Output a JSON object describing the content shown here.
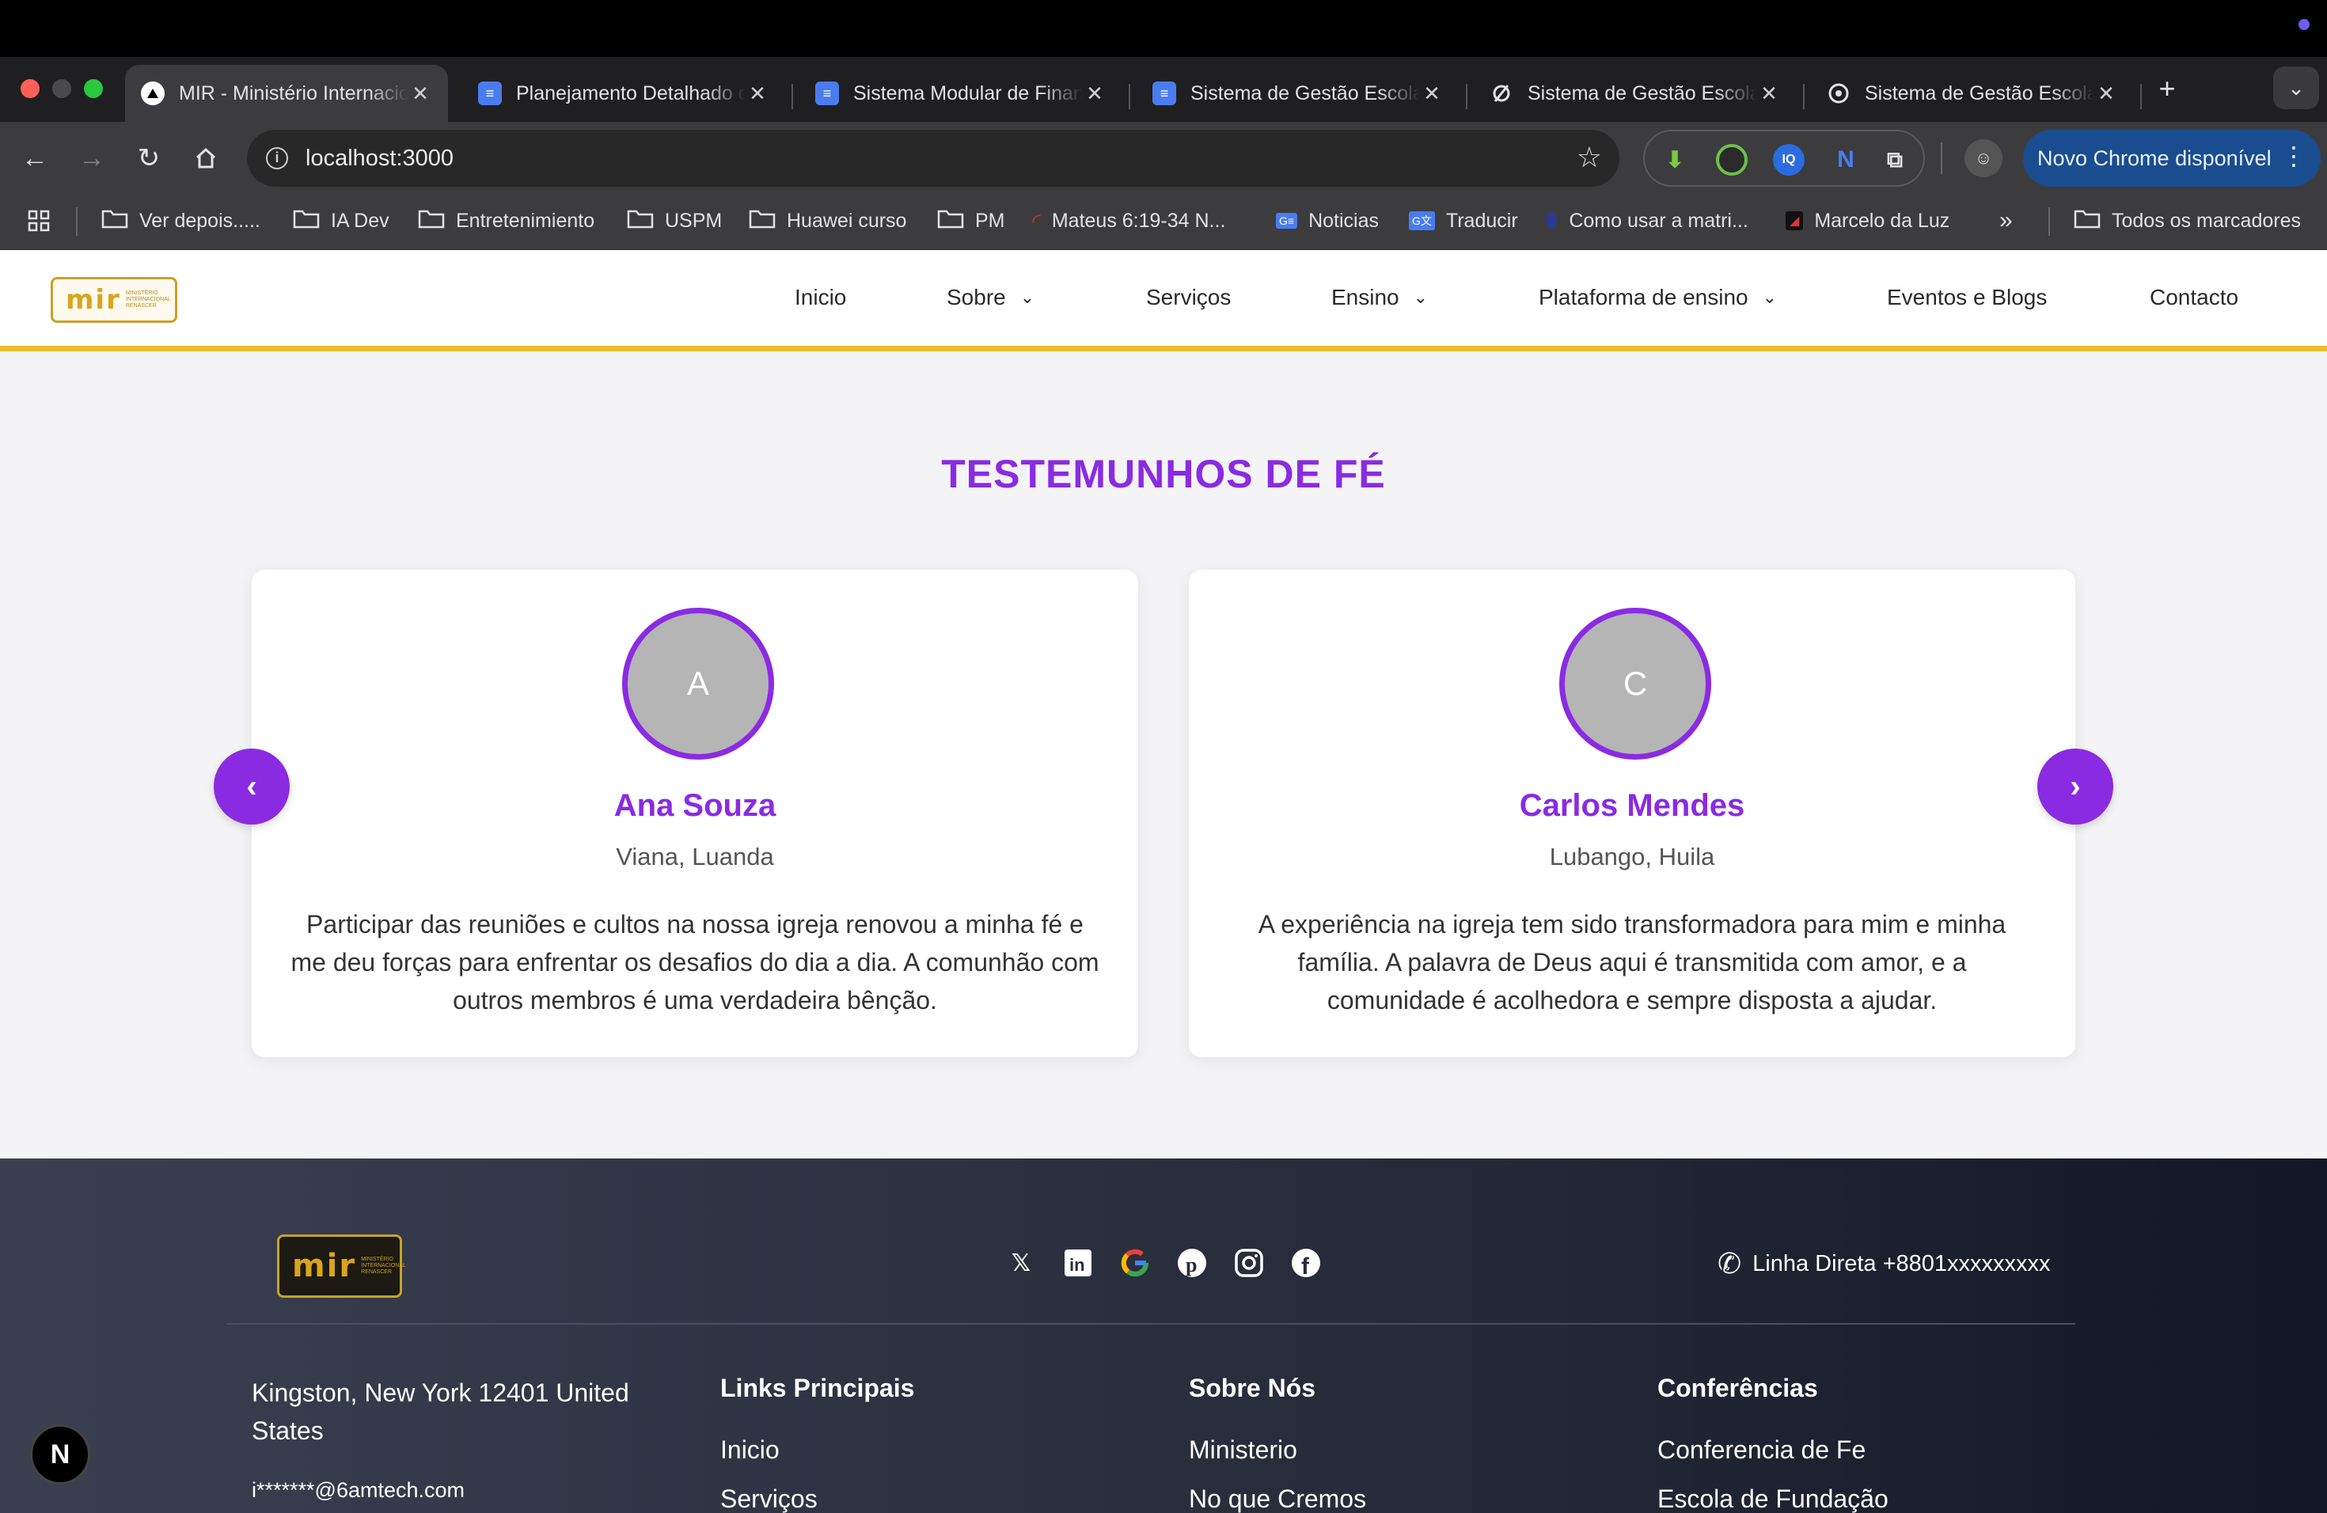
{
  "browser": {
    "tabs": [
      {
        "title": "MIR - Ministério Internacional",
        "favicon": "triangle-icon",
        "active": true
      },
      {
        "title": "Planejamento Detalhado do",
        "favicon": "docs-icon",
        "active": false
      },
      {
        "title": "Sistema Modular de Finanças",
        "favicon": "docs-icon",
        "active": false
      },
      {
        "title": "Sistema de Gestão Escolar",
        "favicon": "docs-icon",
        "active": false
      },
      {
        "title": "Sistema de Gestão Escolar",
        "favicon": "loop-icon",
        "active": false
      },
      {
        "title": "Sistema de Gestão Escolar",
        "favicon": "openai-icon",
        "active": false
      }
    ],
    "url": "localhost:3000",
    "update_label": "Novo Chrome disponível",
    "bookmarks": [
      "Ver depois.....",
      "IA Dev",
      "Entretenimiento",
      "USPM",
      "Huawei curso",
      "PM",
      "Mateus 6:19-34 N...",
      "Noticias",
      "Traducir",
      "Como usar a matri...",
      "Marcelo da Luz"
    ],
    "all_bookmarks": "Todos os marcadores",
    "more_bookmarks": "»"
  },
  "site": {
    "logo_text": "mir",
    "logo_subtext": "MINISTÉRIO INTERNACIONAL RENASCER",
    "nav": [
      "Inicio",
      "Sobre",
      "Serviços",
      "Ensino",
      "Plataforma de ensino",
      "Eventos e Blogs",
      "Contacto"
    ]
  },
  "testimonials": {
    "title": "TESTEMUNHOS DE FÉ",
    "items": [
      {
        "initial": "A",
        "name": "Ana Souza",
        "location": "Viana, Luanda",
        "quote": "Participar das reuniões e cultos na nossa igreja renovou a minha fé e me deu forças para enfrentar os desafios do dia a dia. A comunhão com outros membros é uma verdadeira bênção."
      },
      {
        "initial": "C",
        "name": "Carlos Mendes",
        "location": "Lubango, Huila",
        "quote": "A experiência na igreja tem sido transformadora para mim e minha família. A palavra de Deus aqui é transmitida com amor, e a comunidade é acolhedora e sempre disposta a ajudar."
      }
    ],
    "prev_icon": "‹",
    "next_icon": "›"
  },
  "footer": {
    "hotline": "Linha Direta +8801xxxxxxxxx",
    "address": "Kingston, New York 12401 United States",
    "email": "i*******@6amtech.com",
    "social": [
      "x-icon",
      "linkedin-icon",
      "google-icon",
      "pinterest-icon",
      "instagram-icon",
      "facebook-icon"
    ],
    "columns": [
      {
        "heading": "Links Principais",
        "links": [
          "Inicio",
          "Serviços"
        ]
      },
      {
        "heading": "Sobre Nós",
        "links": [
          "Ministerio",
          "No que Cremos"
        ]
      },
      {
        "heading": "Conferências",
        "links": [
          "Conferencia de Fe",
          "Escola de Fundação"
        ]
      }
    ]
  },
  "dev_badge": "N",
  "colors": {
    "accent": "#8a2be2",
    "gold": "#e8bd2e",
    "footer_dark": "#1b1f2e"
  }
}
